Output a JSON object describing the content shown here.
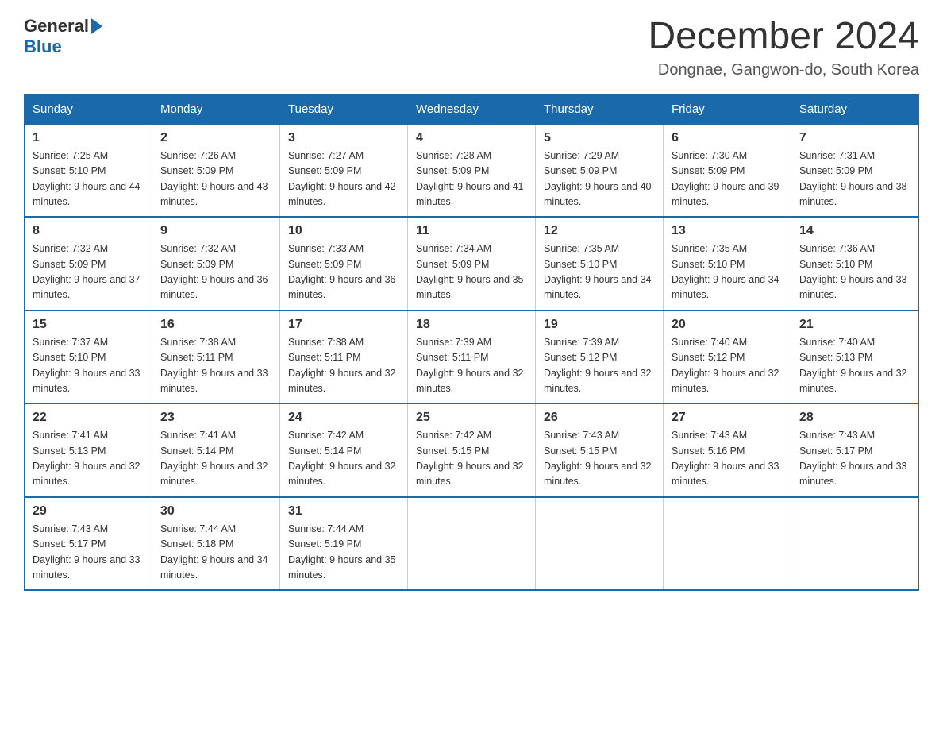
{
  "header": {
    "logo_general": "General",
    "logo_blue": "Blue",
    "title": "December 2024",
    "subtitle": "Dongnae, Gangwon-do, South Korea"
  },
  "weekdays": [
    "Sunday",
    "Monday",
    "Tuesday",
    "Wednesday",
    "Thursday",
    "Friday",
    "Saturday"
  ],
  "weeks": [
    [
      {
        "day": "1",
        "sunrise": "7:25 AM",
        "sunset": "5:10 PM",
        "daylight": "9 hours and 44 minutes."
      },
      {
        "day": "2",
        "sunrise": "7:26 AM",
        "sunset": "5:09 PM",
        "daylight": "9 hours and 43 minutes."
      },
      {
        "day": "3",
        "sunrise": "7:27 AM",
        "sunset": "5:09 PM",
        "daylight": "9 hours and 42 minutes."
      },
      {
        "day": "4",
        "sunrise": "7:28 AM",
        "sunset": "5:09 PM",
        "daylight": "9 hours and 41 minutes."
      },
      {
        "day": "5",
        "sunrise": "7:29 AM",
        "sunset": "5:09 PM",
        "daylight": "9 hours and 40 minutes."
      },
      {
        "day": "6",
        "sunrise": "7:30 AM",
        "sunset": "5:09 PM",
        "daylight": "9 hours and 39 minutes."
      },
      {
        "day": "7",
        "sunrise": "7:31 AM",
        "sunset": "5:09 PM",
        "daylight": "9 hours and 38 minutes."
      }
    ],
    [
      {
        "day": "8",
        "sunrise": "7:32 AM",
        "sunset": "5:09 PM",
        "daylight": "9 hours and 37 minutes."
      },
      {
        "day": "9",
        "sunrise": "7:32 AM",
        "sunset": "5:09 PM",
        "daylight": "9 hours and 36 minutes."
      },
      {
        "day": "10",
        "sunrise": "7:33 AM",
        "sunset": "5:09 PM",
        "daylight": "9 hours and 36 minutes."
      },
      {
        "day": "11",
        "sunrise": "7:34 AM",
        "sunset": "5:09 PM",
        "daylight": "9 hours and 35 minutes."
      },
      {
        "day": "12",
        "sunrise": "7:35 AM",
        "sunset": "5:10 PM",
        "daylight": "9 hours and 34 minutes."
      },
      {
        "day": "13",
        "sunrise": "7:35 AM",
        "sunset": "5:10 PM",
        "daylight": "9 hours and 34 minutes."
      },
      {
        "day": "14",
        "sunrise": "7:36 AM",
        "sunset": "5:10 PM",
        "daylight": "9 hours and 33 minutes."
      }
    ],
    [
      {
        "day": "15",
        "sunrise": "7:37 AM",
        "sunset": "5:10 PM",
        "daylight": "9 hours and 33 minutes."
      },
      {
        "day": "16",
        "sunrise": "7:38 AM",
        "sunset": "5:11 PM",
        "daylight": "9 hours and 33 minutes."
      },
      {
        "day": "17",
        "sunrise": "7:38 AM",
        "sunset": "5:11 PM",
        "daylight": "9 hours and 32 minutes."
      },
      {
        "day": "18",
        "sunrise": "7:39 AM",
        "sunset": "5:11 PM",
        "daylight": "9 hours and 32 minutes."
      },
      {
        "day": "19",
        "sunrise": "7:39 AM",
        "sunset": "5:12 PM",
        "daylight": "9 hours and 32 minutes."
      },
      {
        "day": "20",
        "sunrise": "7:40 AM",
        "sunset": "5:12 PM",
        "daylight": "9 hours and 32 minutes."
      },
      {
        "day": "21",
        "sunrise": "7:40 AM",
        "sunset": "5:13 PM",
        "daylight": "9 hours and 32 minutes."
      }
    ],
    [
      {
        "day": "22",
        "sunrise": "7:41 AM",
        "sunset": "5:13 PM",
        "daylight": "9 hours and 32 minutes."
      },
      {
        "day": "23",
        "sunrise": "7:41 AM",
        "sunset": "5:14 PM",
        "daylight": "9 hours and 32 minutes."
      },
      {
        "day": "24",
        "sunrise": "7:42 AM",
        "sunset": "5:14 PM",
        "daylight": "9 hours and 32 minutes."
      },
      {
        "day": "25",
        "sunrise": "7:42 AM",
        "sunset": "5:15 PM",
        "daylight": "9 hours and 32 minutes."
      },
      {
        "day": "26",
        "sunrise": "7:43 AM",
        "sunset": "5:15 PM",
        "daylight": "9 hours and 32 minutes."
      },
      {
        "day": "27",
        "sunrise": "7:43 AM",
        "sunset": "5:16 PM",
        "daylight": "9 hours and 33 minutes."
      },
      {
        "day": "28",
        "sunrise": "7:43 AM",
        "sunset": "5:17 PM",
        "daylight": "9 hours and 33 minutes."
      }
    ],
    [
      {
        "day": "29",
        "sunrise": "7:43 AM",
        "sunset": "5:17 PM",
        "daylight": "9 hours and 33 minutes."
      },
      {
        "day": "30",
        "sunrise": "7:44 AM",
        "sunset": "5:18 PM",
        "daylight": "9 hours and 34 minutes."
      },
      {
        "day": "31",
        "sunrise": "7:44 AM",
        "sunset": "5:19 PM",
        "daylight": "9 hours and 35 minutes."
      },
      null,
      null,
      null,
      null
    ]
  ]
}
